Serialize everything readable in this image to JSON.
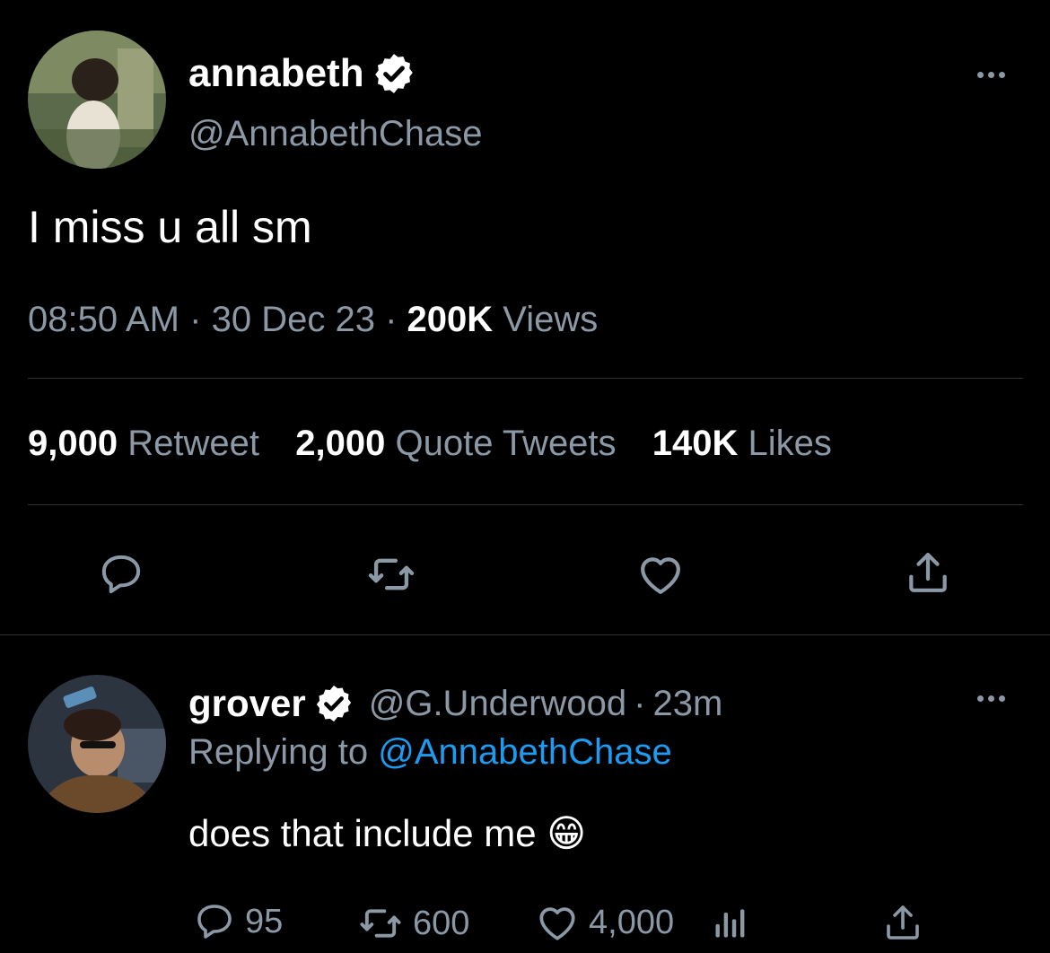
{
  "tweet": {
    "author_name": "annabeth",
    "author_handle": "@AnnabethChase",
    "text": "I miss u all sm",
    "time": "08:50 AM",
    "date": "30 Dec 23",
    "views_count": "200K",
    "views_label": "Views",
    "sep": "·",
    "stats": {
      "retweet_count": "9,000",
      "retweet_label": "Retweet",
      "quote_count": "2,000",
      "quote_label": "Quote Tweets",
      "likes_count": "140K",
      "likes_label": "Likes"
    }
  },
  "reply": {
    "author_name": "grover",
    "author_handle": "@G.Underwood",
    "sep": "·",
    "age": "23m",
    "replying_prefix": "Replying to",
    "replying_handle": "@AnnabethChase",
    "text": "does that include me",
    "emoji": "😁",
    "stats": {
      "replies": "95",
      "retweets": "600",
      "likes": "4,000"
    }
  },
  "icons": {
    "verified": "verified-badge-icon",
    "more": "more-icon",
    "reply": "reply-icon",
    "retweet": "retweet-icon",
    "like": "heart-icon",
    "share": "share-icon",
    "analytics": "analytics-icon"
  },
  "colors": {
    "background": "#000000",
    "text": "#ffffff",
    "muted": "#8b98a5",
    "link": "#1d9bf0",
    "divider": "#2f3336"
  }
}
